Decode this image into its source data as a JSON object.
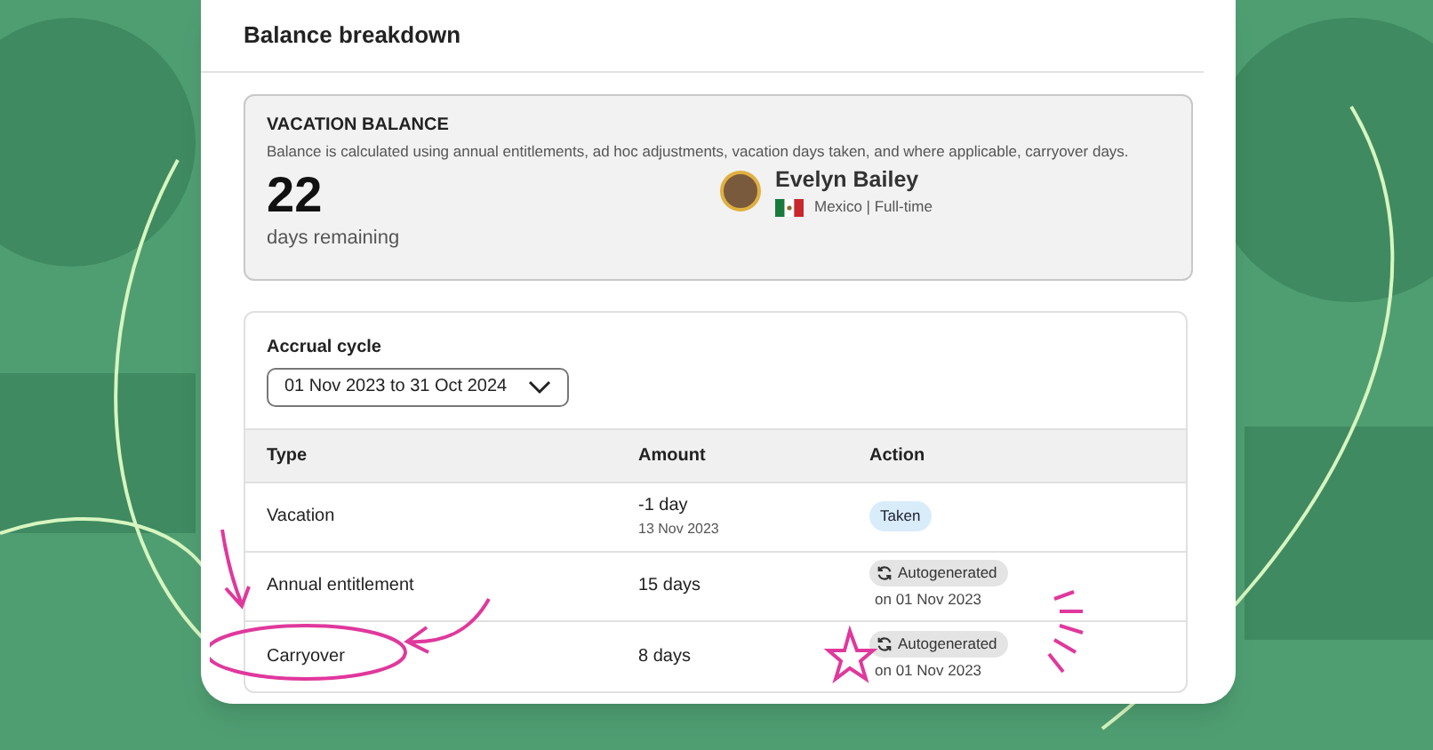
{
  "title": "Balance breakdown",
  "balance": {
    "heading": "VACATION BALANCE",
    "description": "Balance is calculated using annual entitlements, ad hoc adjustments, vacation days taken, and where applicable, carryover days.",
    "days": "22",
    "days_label": "days remaining"
  },
  "employee": {
    "name": "Evelyn Bailey",
    "meta": "Mexico | Full-time"
  },
  "accrual": {
    "label": "Accrual cycle",
    "value": "01 Nov 2023 to 31 Oct 2024"
  },
  "table": {
    "columns": [
      "Type",
      "Amount",
      "Action"
    ],
    "rows": [
      {
        "type": "Vacation",
        "amount": "-1 day",
        "date": "13 Nov 2023",
        "action": {
          "kind": "taken",
          "label": "Taken"
        }
      },
      {
        "type": "Annual entitlement",
        "amount": "15 days",
        "action": {
          "kind": "auto",
          "label": "Autogenerated",
          "note": "on 01 Nov 2023"
        }
      },
      {
        "type": "Carryover",
        "amount": "8 days",
        "action": {
          "kind": "auto",
          "label": "Autogenerated",
          "note": "on 01 Nov 2023"
        }
      }
    ]
  }
}
